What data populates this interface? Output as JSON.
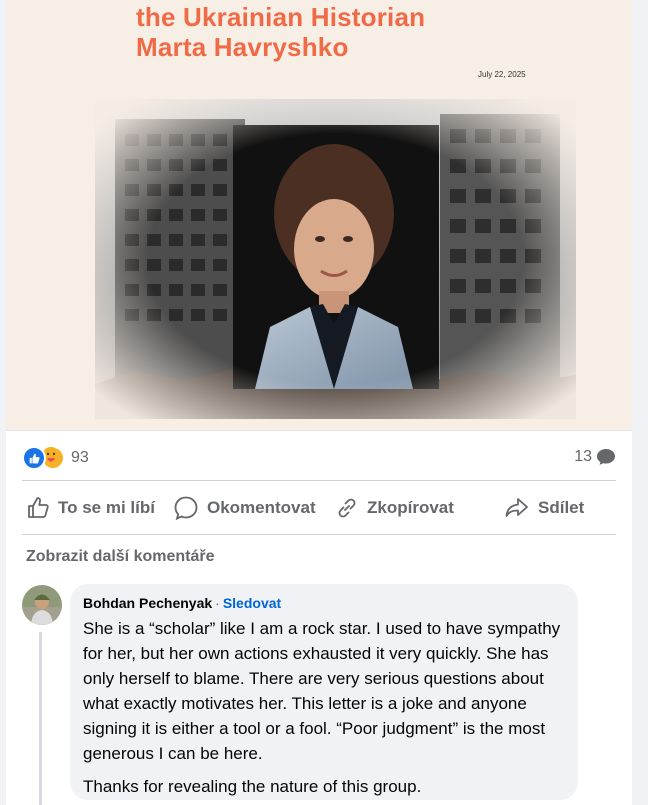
{
  "post": {
    "headline_lines": [
      "the Ukrainian Historian",
      "Marta Havryshko"
    ],
    "date": "July 22, 2025",
    "colors": {
      "headline": "#f06a46",
      "banner_bg": "#f7eee6"
    }
  },
  "reactions": {
    "count": "93",
    "icons": [
      "like-icon",
      "care-icon"
    ],
    "comments": "13"
  },
  "actions": {
    "like": "To se mi líbí",
    "comment": "Okomentovat",
    "copy": "Zkopírovat",
    "share": "Sdílet"
  },
  "comments_section": {
    "more_label": "Zobrazit další komentáře"
  },
  "comment": {
    "author": "Bohdan Pechenyak",
    "separator": "·",
    "follow": "Sledovat",
    "paragraph1": "She is a “scholar” like I am a rock star. I used to have sympathy for her, but her own actions exhausted it very quickly. She has only herself to blame. There are very serious questions about what exactly motivates her. This letter is a joke and anyone signing it is either a tool or a fool. “Poor judgment” is the most generous I can be here.",
    "paragraph2": "Thanks for revealing the nature of this group."
  }
}
